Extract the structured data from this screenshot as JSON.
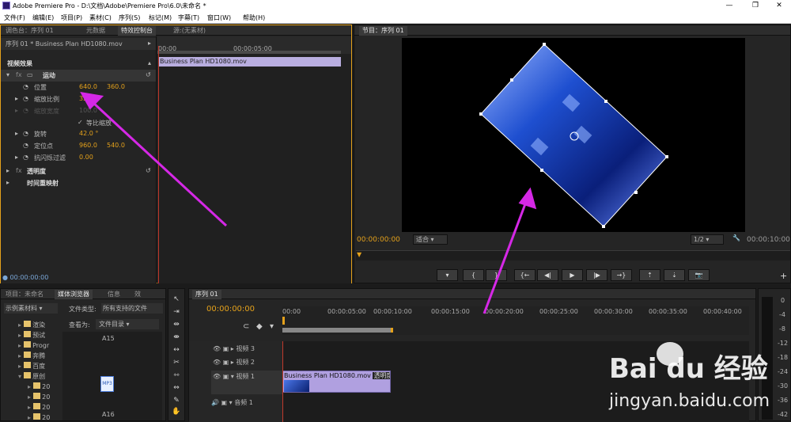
{
  "app": {
    "title": "Adobe Premiere Pro - D:\\文档\\Adobe\\Premiere Pro\\6.0\\未命名 *",
    "minimize": "—",
    "maximize": "❐",
    "close": "✕"
  },
  "menu": [
    "文件(F)",
    "编辑(E)",
    "项目(P)",
    "素材(C)",
    "序列(S)",
    "标记(M)",
    "字幕(T)",
    "窗口(W)",
    "帮助(H)"
  ],
  "effect_panel": {
    "tabs": [
      "调色台：序列 01",
      "元数据",
      "特效控制台",
      "源:(无素材)"
    ],
    "sequence_label": "序列 01 * Business Plan HD1080.mov",
    "clip_label": "Business Plan HD1080.mov",
    "section": "视频效果",
    "motion": "运动",
    "position_label": "位置",
    "position_x": "640.0",
    "position_y": "360.0",
    "scale_label": "缩放比例",
    "scale": "32.0",
    "scale_width_label": "缩放宽度",
    "scale_width": "100.0",
    "uniform_label": "等比缩放",
    "rotation_label": "旋转",
    "rotation": "42.0 °",
    "anchor_label": "定位点",
    "anchor_x": "960.0",
    "anchor_y": "540.0",
    "antiflicker_label": "抗闪烁过滤",
    "antiflicker": "0.00",
    "opacity": "透明度",
    "time_remap": "时间重映射",
    "ruler_start": "00:00",
    "ruler_mid": "00:00:05:00",
    "timecode": "00:00:00:00"
  },
  "program_monitor": {
    "tab": "节目：序列 01",
    "timecode_left": "00:00:00:00",
    "fit": "适合",
    "resolution": "1/2",
    "timecode_right": "00:00:10:00"
  },
  "project_panel": {
    "tabs": [
      "项目：未命名",
      "媒体浏览器",
      "信息",
      "效"
    ],
    "location": "示例素材料",
    "file_type_label": "文件类型:",
    "file_type": "所有支持的文件",
    "view_label": "查看为:",
    "view": "文件目录",
    "folders": [
      "渲染",
      "预试",
      "Progr",
      "奔腾",
      "百度",
      "原创",
      "20",
      "20",
      "20",
      "20"
    ],
    "thumb_label_top": "A15",
    "thumb_label_bottom": "A16"
  },
  "timeline": {
    "tab": "序列 01",
    "timecode": "00:00:00:00",
    "ruler": [
      "00:00",
      "00:00:05:00",
      "00:00:10:00",
      "00:00:15:00",
      "00:00:20:00",
      "00:00:25:00",
      "00:00:30:00",
      "00:00:35:00",
      "00:00:40:00"
    ],
    "tracks": [
      "视频 3",
      "视频 2",
      "视频 1",
      "音频 1"
    ],
    "clip_name": "Business Plan HD1080.mov",
    "clip_effect": "透明度"
  },
  "audio_meter": [
    "0",
    "-4",
    "-8",
    "-12",
    "-18",
    "-24",
    "-30",
    "-36",
    "-42"
  ],
  "watermark": {
    "brand": "Bai du 经验",
    "url": "jingyan.baidu.com"
  },
  "colors": {
    "accent": "#e4a11b",
    "annotation": "#d528e6",
    "panel": "#252525",
    "clip": "#b0a0e0"
  }
}
